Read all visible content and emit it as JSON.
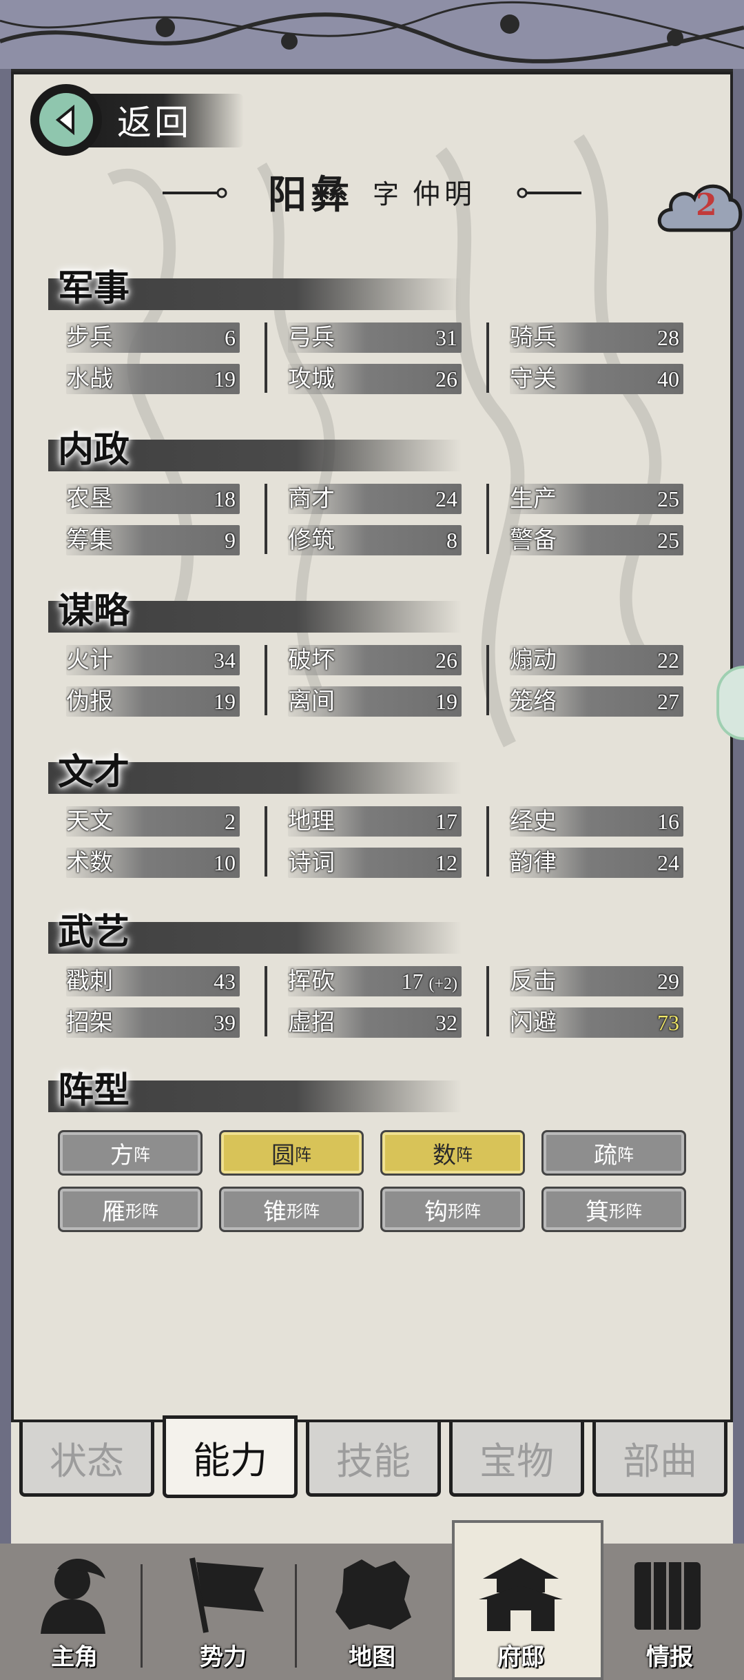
{
  "back": {
    "label": "返回"
  },
  "character": {
    "name": "阳彝",
    "zi_label": "字",
    "courtesy": "仲明"
  },
  "badge": {
    "count": "2"
  },
  "sections": [
    {
      "title": "军事",
      "stats": [
        {
          "label": "步兵",
          "value": "6"
        },
        {
          "label": "弓兵",
          "value": "31"
        },
        {
          "label": "骑兵",
          "value": "28"
        },
        {
          "label": "水战",
          "value": "19"
        },
        {
          "label": "攻城",
          "value": "26"
        },
        {
          "label": "守关",
          "value": "40"
        }
      ]
    },
    {
      "title": "内政",
      "stats": [
        {
          "label": "农垦",
          "value": "18"
        },
        {
          "label": "商才",
          "value": "24"
        },
        {
          "label": "生产",
          "value": "25"
        },
        {
          "label": "筹集",
          "value": "9"
        },
        {
          "label": "修筑",
          "value": "8"
        },
        {
          "label": "警备",
          "value": "25"
        }
      ]
    },
    {
      "title": "谋略",
      "stats": [
        {
          "label": "火计",
          "value": "34"
        },
        {
          "label": "破坏",
          "value": "26"
        },
        {
          "label": "煽动",
          "value": "22"
        },
        {
          "label": "伪报",
          "value": "19"
        },
        {
          "label": "离间",
          "value": "19"
        },
        {
          "label": "笼络",
          "value": "27"
        }
      ]
    },
    {
      "title": "文才",
      "stats": [
        {
          "label": "天文",
          "value": "2"
        },
        {
          "label": "地理",
          "value": "17"
        },
        {
          "label": "经史",
          "value": "16"
        },
        {
          "label": "术数",
          "value": "10"
        },
        {
          "label": "诗词",
          "value": "12"
        },
        {
          "label": "韵律",
          "value": "24"
        }
      ]
    },
    {
      "title": "武艺",
      "stats": [
        {
          "label": "戳刺",
          "value": "43"
        },
        {
          "label": "挥砍",
          "value": "17",
          "bonus": "(+2)"
        },
        {
          "label": "反击",
          "value": "29"
        },
        {
          "label": "招架",
          "value": "39"
        },
        {
          "label": "虚招",
          "value": "32"
        },
        {
          "label": "闪避",
          "value": "73",
          "highlight": true
        }
      ]
    }
  ],
  "formation": {
    "title": "阵型",
    "items": [
      {
        "big": "方",
        "small": "阵",
        "active": false
      },
      {
        "big": "圆",
        "small": "阵",
        "active": true
      },
      {
        "big": "数",
        "small": "阵",
        "active": true
      },
      {
        "big": "疏",
        "small": "阵",
        "active": false
      },
      {
        "big": "雁",
        "small": "形阵",
        "active": false
      },
      {
        "big": "锥",
        "small": "形阵",
        "active": false
      },
      {
        "big": "钩",
        "small": "形阵",
        "active": false
      },
      {
        "big": "箕",
        "small": "形阵",
        "active": false
      }
    ]
  },
  "tabs": [
    {
      "label": "状态",
      "active": false
    },
    {
      "label": "能力",
      "active": true
    },
    {
      "label": "技能",
      "active": false
    },
    {
      "label": "宝物",
      "active": false
    },
    {
      "label": "部曲",
      "active": false
    }
  ],
  "nav": [
    {
      "label": "主角",
      "icon": "hero-icon",
      "active": false
    },
    {
      "label": "势力",
      "icon": "flag-icon",
      "active": false
    },
    {
      "label": "地图",
      "icon": "map-icon",
      "active": false
    },
    {
      "label": "府邸",
      "icon": "mansion-icon",
      "active": true
    },
    {
      "label": "情报",
      "icon": "scroll-icon",
      "active": false
    }
  ],
  "colors": {
    "active_button": "#d8c358",
    "highlight_value": "#f2e96a",
    "badge_text": "#c23a3a"
  }
}
